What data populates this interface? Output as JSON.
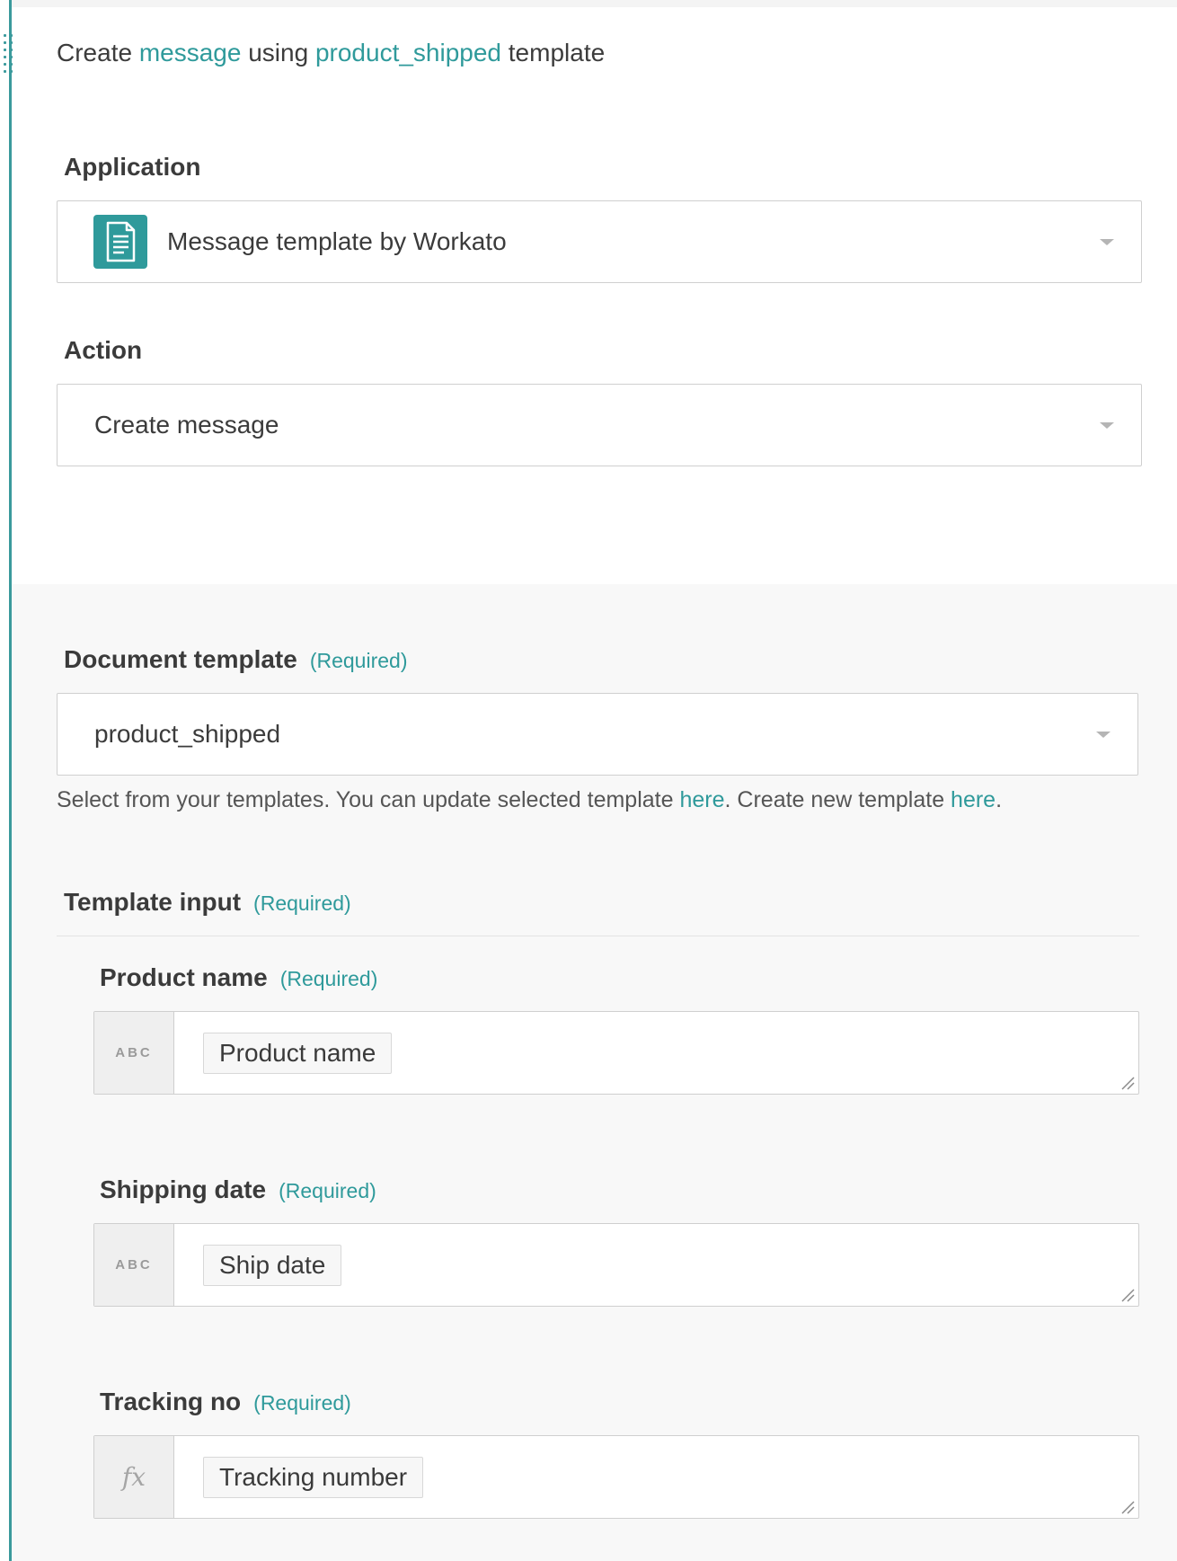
{
  "header": {
    "prefix": "Create ",
    "object": "message",
    "middle": " using ",
    "template": "product_shipped",
    "suffix": " template"
  },
  "application": {
    "label": "Application",
    "value": "Message template by Workato",
    "icon": "document-icon"
  },
  "action": {
    "label": "Action",
    "value": "Create message"
  },
  "document_template": {
    "label": "Document template",
    "required": "(Required)",
    "value": "product_shipped",
    "hint_part1": "Select from your templates. You can update selected template ",
    "hint_link1": "here",
    "hint_part2": ". Create new template ",
    "hint_link2": "here",
    "hint_part3": "."
  },
  "template_input": {
    "label": "Template input",
    "required": "(Required)",
    "fields": [
      {
        "label": "Product name",
        "required": "(Required)",
        "type": "ABC",
        "pill": "Product name"
      },
      {
        "label": "Shipping date",
        "required": "(Required)",
        "type": "ABC",
        "pill": "Ship date"
      },
      {
        "label": "Tracking no",
        "required": "(Required)",
        "type": "fx",
        "pill": "Tracking number"
      }
    ]
  },
  "colors": {
    "accent": "#2f9a9b",
    "panel": "#f8f8f8"
  }
}
